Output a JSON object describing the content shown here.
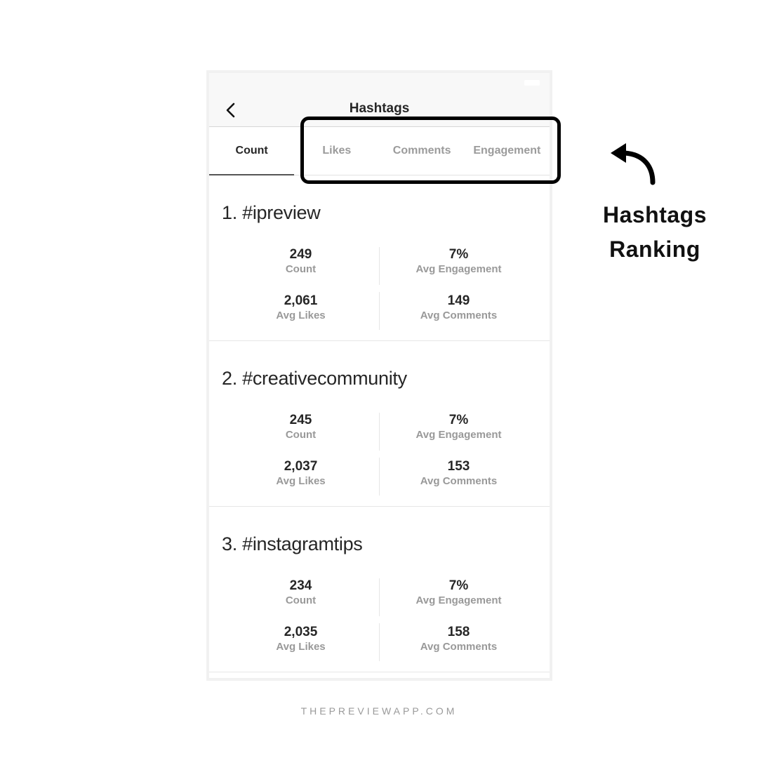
{
  "navbar": {
    "title": "Hashtags",
    "back_icon": "chevron-left-icon"
  },
  "tabs": [
    {
      "label": "Count",
      "active": true
    },
    {
      "label": "Likes",
      "active": false
    },
    {
      "label": "Comments",
      "active": false
    },
    {
      "label": "Engagement",
      "active": false
    }
  ],
  "hashtags": [
    {
      "title": "1. #ipreview",
      "count": "249",
      "count_label": "Count",
      "avg_engagement": "7%",
      "avg_engagement_label": "Avg Engagement",
      "avg_likes": "2,061",
      "avg_likes_label": "Avg Likes",
      "avg_comments": "149",
      "avg_comments_label": "Avg Comments"
    },
    {
      "title": "2. #creativecommunity",
      "count": "245",
      "count_label": "Count",
      "avg_engagement": "7%",
      "avg_engagement_label": "Avg Engagement",
      "avg_likes": "2,037",
      "avg_likes_label": "Avg Likes",
      "avg_comments": "153",
      "avg_comments_label": "Avg Comments"
    },
    {
      "title": "3. #instagramtips",
      "count": "234",
      "count_label": "Count",
      "avg_engagement": "7%",
      "avg_engagement_label": "Avg Engagement",
      "avg_likes": "2,035",
      "avg_likes_label": "Avg Likes",
      "avg_comments": "158",
      "avg_comments_label": "Avg Comments"
    }
  ],
  "annotation": {
    "line1": "Hashtags",
    "line2": "Ranking",
    "arrow_icon": "curved-arrow-icon"
  },
  "footer": {
    "text": "THEPREVIEWAPP.COM"
  },
  "colors": {
    "text_primary": "#262626",
    "text_secondary": "#999999",
    "highlight_border": "#000000"
  }
}
